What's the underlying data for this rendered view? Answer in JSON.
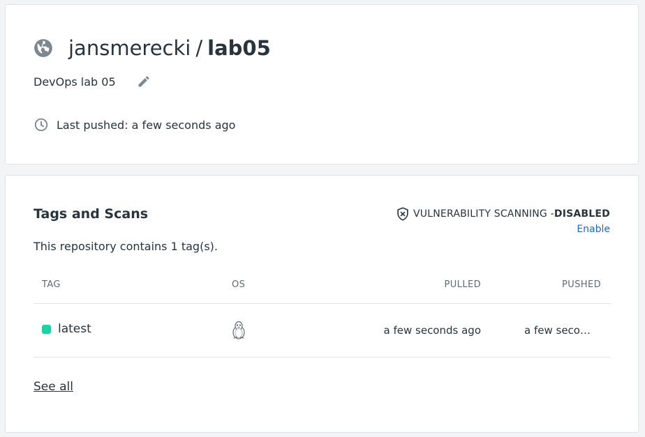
{
  "repo": {
    "namespace": "jansmerecki",
    "separator": "/",
    "name": "lab05",
    "description": "DevOps lab 05",
    "last_pushed": "Last pushed: a few seconds ago"
  },
  "tags_section": {
    "title": "Tags and Scans",
    "vuln_label": "VULNERABILITY SCANNING - ",
    "vuln_status": "DISABLED",
    "enable_link": "Enable",
    "count_text": "This repository contains 1 tag(s).",
    "columns": {
      "tag": "TAG",
      "os": "OS",
      "pulled": "PULLED",
      "pushed": "PUSHED"
    },
    "rows": [
      {
        "tag": "latest",
        "os_icon": "linux-tux-icon",
        "pulled": "a few seconds ago",
        "pushed": "a few seconds ago"
      }
    ],
    "see_all": "See all"
  },
  "colors": {
    "accent_link": "#1d63ed",
    "status_dot": "#1ed1a0",
    "text": "#27343d",
    "icon_gray": "#7d8790"
  },
  "icons": [
    "globe-icon",
    "edit-pencil-icon",
    "clock-icon",
    "shield-x-icon",
    "linux-tux-icon"
  ]
}
